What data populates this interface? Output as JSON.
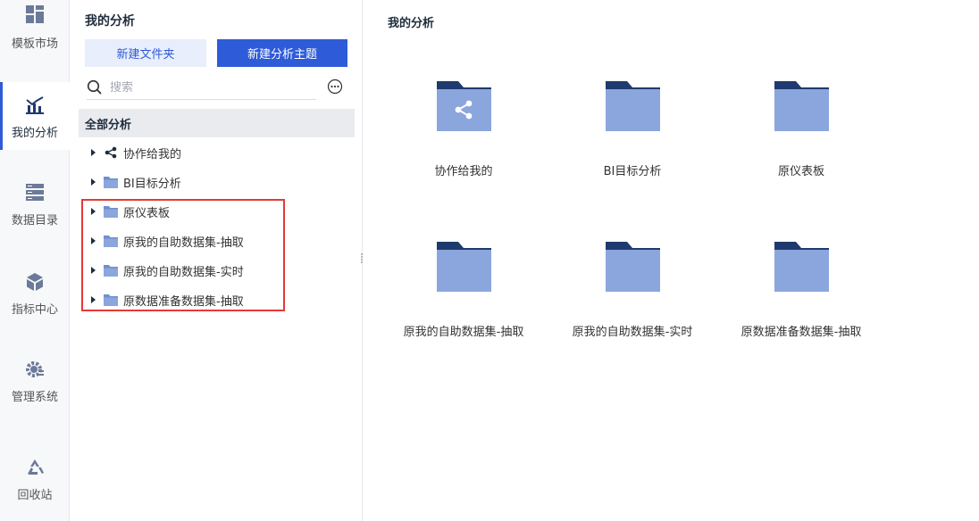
{
  "nav": {
    "items": [
      {
        "label": "模板市场",
        "icon": "template-grid-icon"
      },
      {
        "label": "我的分析",
        "icon": "analysis-chart-icon",
        "active": true
      },
      {
        "label": "数据目录",
        "icon": "data-catalog-icon"
      },
      {
        "label": "指标中心",
        "icon": "metrics-cube-icon"
      },
      {
        "label": "管理系统",
        "icon": "gear-icon"
      },
      {
        "label": "回收站",
        "icon": "recycle-icon"
      }
    ]
  },
  "tree": {
    "title": "我的分析",
    "new_folder_label": "新建文件夹",
    "new_subject_label": "新建分析主题",
    "search_placeholder": "搜索",
    "all_label": "全部分析",
    "items": [
      {
        "label": "协作给我的",
        "icon": "share-icon"
      },
      {
        "label": "BI目标分析",
        "icon": "folder-icon"
      },
      {
        "label": "原仪表板",
        "icon": "folder-icon"
      },
      {
        "label": "原我的自助数据集-抽取",
        "icon": "folder-icon"
      },
      {
        "label": "原我的自助数据集-实时",
        "icon": "folder-icon"
      },
      {
        "label": "原数据准备数据集-抽取",
        "icon": "folder-icon"
      }
    ]
  },
  "main": {
    "title": "我的分析",
    "tiles": [
      {
        "label": "协作给我的",
        "icon": "shared-folder-icon"
      },
      {
        "label": "BI目标分析",
        "icon": "folder-icon"
      },
      {
        "label": "原仪表板",
        "icon": "folder-icon"
      },
      {
        "label": "原我的自助数据集-抽取",
        "icon": "folder-icon"
      },
      {
        "label": "原我的自助数据集-实时",
        "icon": "folder-icon"
      },
      {
        "label": "原数据准备数据集-抽取",
        "icon": "folder-icon"
      }
    ]
  },
  "colors": {
    "accent": "#2e5bd8",
    "folder_body": "#8aa6dc",
    "folder_tab": "#1f3a6e",
    "highlight": "#e53935"
  }
}
